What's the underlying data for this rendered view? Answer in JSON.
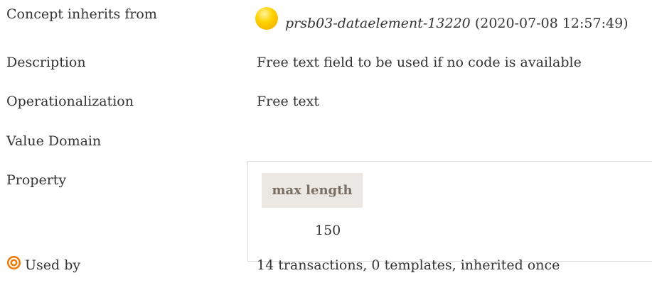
{
  "rows": {
    "inherits": {
      "label": "Concept inherits from",
      "link": "prsb03-dataelement-13220",
      "date": "(2020-07-08 12:57:49)"
    },
    "description": {
      "label": "Description",
      "value": "Free text field to be used if no code is available"
    },
    "operationalization": {
      "label": "Operationalization",
      "value": "Free text"
    },
    "value_domain": {
      "label": "Value Domain"
    },
    "property": {
      "label": "Property",
      "header": "max length",
      "value": "150"
    },
    "used_by": {
      "label": "Used by",
      "value": "14 transactions, 0 templates, inherited once"
    }
  },
  "icons": {
    "inherits": "yellow-ball-icon",
    "used_by": "target-icon"
  },
  "colors": {
    "accent_orange": "#f07800",
    "header_bg": "#ebe8e3"
  }
}
